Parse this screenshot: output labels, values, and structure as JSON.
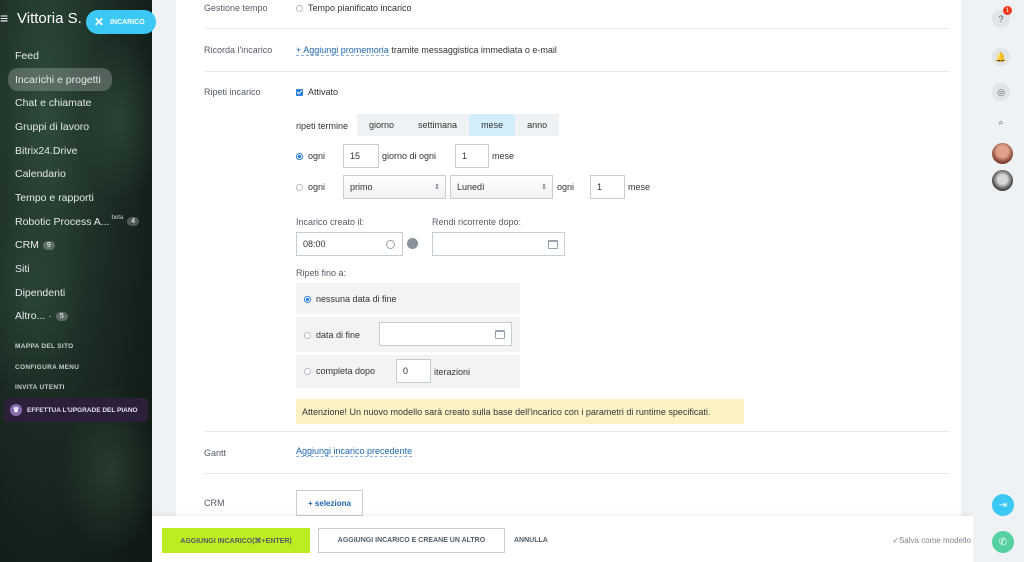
{
  "sidebar": {
    "brand": "Vittoria S.",
    "task_chip": "INCARICO",
    "items": [
      {
        "label": "Feed"
      },
      {
        "label": "Incarichi e progetti"
      },
      {
        "label": "Chat e chiamate"
      },
      {
        "label": "Gruppi di lavoro"
      },
      {
        "label": "Bitrix24.Drive"
      },
      {
        "label": "Calendario"
      },
      {
        "label": "Tempo e rapporti"
      },
      {
        "label": "Robotic Process A...",
        "beta": "beta",
        "count": "4"
      },
      {
        "label": "CRM",
        "count": "9"
      },
      {
        "label": "Siti"
      },
      {
        "label": "Dipendenti"
      },
      {
        "label": "Altro...",
        "count": "5"
      }
    ],
    "site_map": "MAPPA DEL SITO",
    "configure_menu": "CONFIGURA MENU",
    "invite_users": "INVITA UTENTI",
    "upgrade": "EFFETTUA L'UPGRADE DEL PIANO"
  },
  "form": {
    "time_management": {
      "label": "Gestione tempo",
      "option": "Tempo pianificato incarico"
    },
    "reminder": {
      "label": "Ricorda l'incarico",
      "link": "+ Aggiungi promemoria",
      "suffix": "tramite messaggistica immediata o e-mail"
    },
    "repeat": {
      "label": "Ripeti incarico",
      "enabled": "Attivato",
      "term_label": "ripeti termine",
      "terms": [
        "giorno",
        "settimana",
        "mese",
        "anno"
      ],
      "selected_term": "mese",
      "every_label": "ogni",
      "day_value": "15",
      "day_of_every": "giorno di ogni",
      "month_value": "1",
      "month_label": "mese",
      "every2_label": "ogni",
      "ordinal_value": "primo",
      "weekday_value": "Lunedì",
      "every3_label": "ogni",
      "month2_value": "1",
      "month2_label": "mese",
      "created_label": "Incarico creato il:",
      "created_time": "08:00",
      "recurring_label": "Rendi ricorrente dopo:",
      "until_label": "Ripeti fino a:",
      "until_options": [
        "nessuna data di fine",
        "data di fine",
        "completa dopo"
      ],
      "iterations_value": "0",
      "iterations_label": "iterazioni",
      "warning": "Attenzione! Un nuovo modello sarà creato sulla base dell'incarico con i parametri di runtime specificati."
    },
    "gantt": {
      "label": "Gantt",
      "link": "Aggiungi incarico precedente"
    },
    "crm": {
      "label": "CRM",
      "button": "+ seleziona"
    }
  },
  "actions": {
    "add_task": "AGGIUNGI INCARICO(⌘+ENTER)",
    "add_another": "AGGIUNGI INCARICO E CREANE UN ALTRO",
    "cancel": "ANNULLA",
    "save_template": "Salva come modello"
  },
  "rail": {
    "help_badge": "1"
  }
}
